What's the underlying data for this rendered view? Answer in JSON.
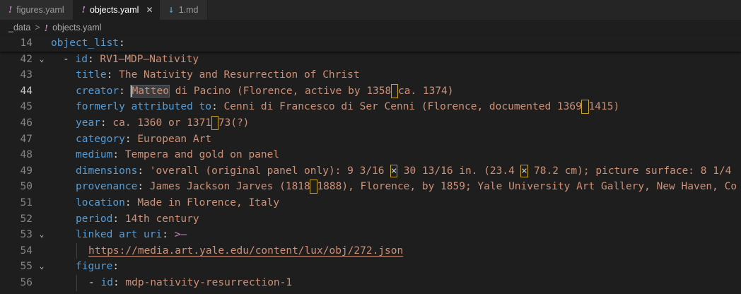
{
  "tabs": [
    {
      "icon": "!",
      "label": "figures.yaml"
    },
    {
      "icon": "!",
      "label": "objects.yaml",
      "close": "✕"
    },
    {
      "icon": "↓",
      "label": "1.md"
    }
  ],
  "breadcrumb": {
    "folder": "_data",
    "separator": ">",
    "file_icon": "!",
    "file": "objects.yaml"
  },
  "lines": {
    "l14": {
      "num": "14",
      "key": "object_list",
      "colon": ":"
    },
    "l42": {
      "num": "42",
      "dash": "- ",
      "key": "id",
      "colon": ": ",
      "val": "RV1–MDP–Nativity"
    },
    "l43": {
      "num": "43",
      "key": "title",
      "colon": ": ",
      "val": "The Nativity and Resurrection of Christ"
    },
    "l44": {
      "num": "44",
      "key": "creator",
      "colon": ": ",
      "word": "Matteo",
      "val1": " di Pacino (Florence, active by 1358",
      "val2": "ca. 1374)"
    },
    "l45": {
      "num": "45",
      "key": "formerly attributed to",
      "colon": ": ",
      "val1": "Cenni di Francesco di Ser Cenni (Florence, documented 1369",
      "val2": "1415)"
    },
    "l46": {
      "num": "46",
      "key": "year",
      "colon": ": ",
      "val1": "ca. 1360 or 1371",
      "val2": "73(?)"
    },
    "l47": {
      "num": "47",
      "key": "category",
      "colon": ": ",
      "val": "European Art"
    },
    "l48": {
      "num": "48",
      "key": "medium",
      "colon": ": ",
      "val": "Tempera and gold on panel"
    },
    "l49": {
      "num": "49",
      "key": "dimensions",
      "colon": ": ",
      "val1": "'overall (original panel only): 9 3/16 ",
      "x1": "×",
      "val2": " 30 13/16 in. (23.4 ",
      "x2": "×",
      "val3": " 78.2 cm); picture surface: 8 1/4"
    },
    "l50": {
      "num": "50",
      "key": "provenance",
      "colon": ": ",
      "val1": "James Jackson Jarves (1818",
      "val2": "1888), Florence, by 1859; Yale University Art Gallery, New Haven, Co"
    },
    "l51": {
      "num": "51",
      "key": "location",
      "colon": ": ",
      "val": "Made in Florence, Italy"
    },
    "l52": {
      "num": "52",
      "key": "period",
      "colon": ": ",
      "val": "14th century"
    },
    "l53": {
      "num": "53",
      "key": "linked art uri",
      "colon": ": ",
      "op": ">–"
    },
    "l54": {
      "num": "54",
      "val": "https://media.art.yale.edu/content/lux/obj/272.json"
    },
    "l55": {
      "num": "55",
      "key": "figure",
      "colon": ":"
    },
    "l56": {
      "num": "56",
      "dash": "- ",
      "key": "id",
      "colon": ": ",
      "val": "mdp-nativity-resurrection-1"
    }
  },
  "fold_icon": "⌄"
}
